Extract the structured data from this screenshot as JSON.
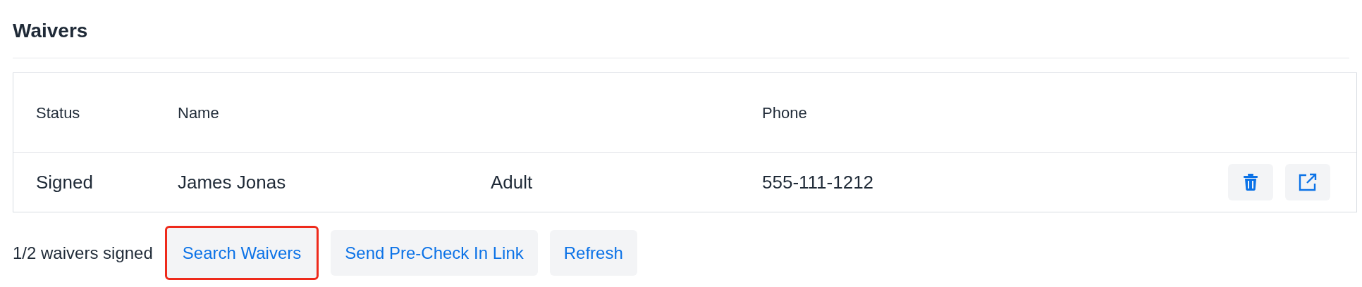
{
  "title": "Waivers",
  "table": {
    "columns": [
      "Status",
      "Name",
      "Phone"
    ],
    "rows": [
      {
        "status": "Signed",
        "name": "James Jonas",
        "type": "Adult",
        "phone": "555-111-1212",
        "actions": [
          {
            "kind": "delete"
          },
          {
            "kind": "open"
          }
        ]
      }
    ]
  },
  "footer": {
    "summary": "1/2 waivers signed",
    "buttons": [
      {
        "label": "Search Waivers",
        "highlighted": true
      },
      {
        "label": "Send Pre-Check In Link",
        "highlighted": false
      },
      {
        "label": "Refresh",
        "highlighted": false
      }
    ]
  }
}
